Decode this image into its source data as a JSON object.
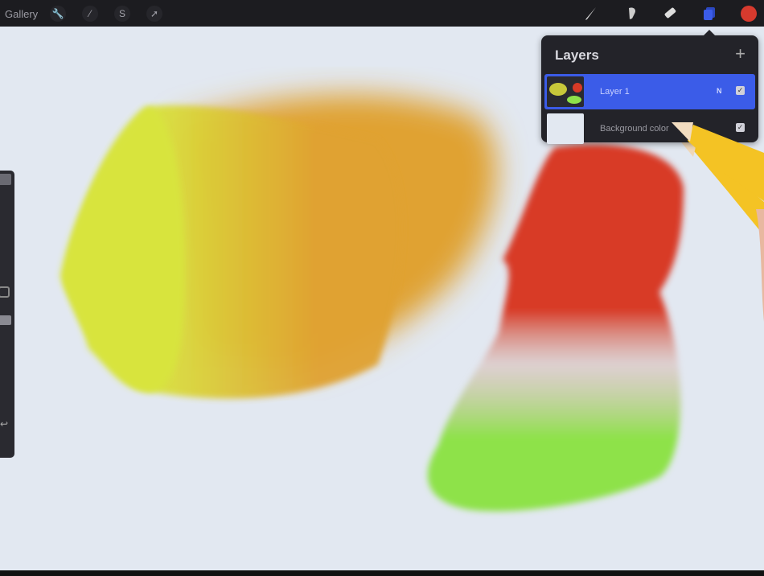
{
  "topbar": {
    "gallery_label": "Gallery",
    "left_tools": [
      {
        "icon": "wrench-icon",
        "glyph": "🔧"
      },
      {
        "icon": "magic-wand-icon",
        "glyph": "⁄"
      },
      {
        "icon": "selection-icon",
        "glyph": "S"
      },
      {
        "icon": "transform-arrow-icon",
        "glyph": "➚"
      }
    ],
    "right_tools": [
      "brush-icon",
      "smudge-icon",
      "eraser-icon",
      "layers-icon",
      "color-swatch"
    ],
    "active_color": "#d63a2e",
    "layers_icon_color": "#3b5ce8"
  },
  "layers_panel": {
    "title": "Layers",
    "add_glyph": "+",
    "layers": [
      {
        "name": "Layer 1",
        "blend_mode": "N",
        "visible": true,
        "selected": true
      },
      {
        "name": "Background color",
        "visible": true,
        "selected": false,
        "swatch": "#e2e8f1"
      }
    ]
  },
  "sidebar": {
    "undo_glyph": "↩"
  },
  "paint_colors": {
    "yellow": "#d8e33c",
    "orange": "#e0a232",
    "red": "#d83a26",
    "green": "#8ee24a"
  }
}
